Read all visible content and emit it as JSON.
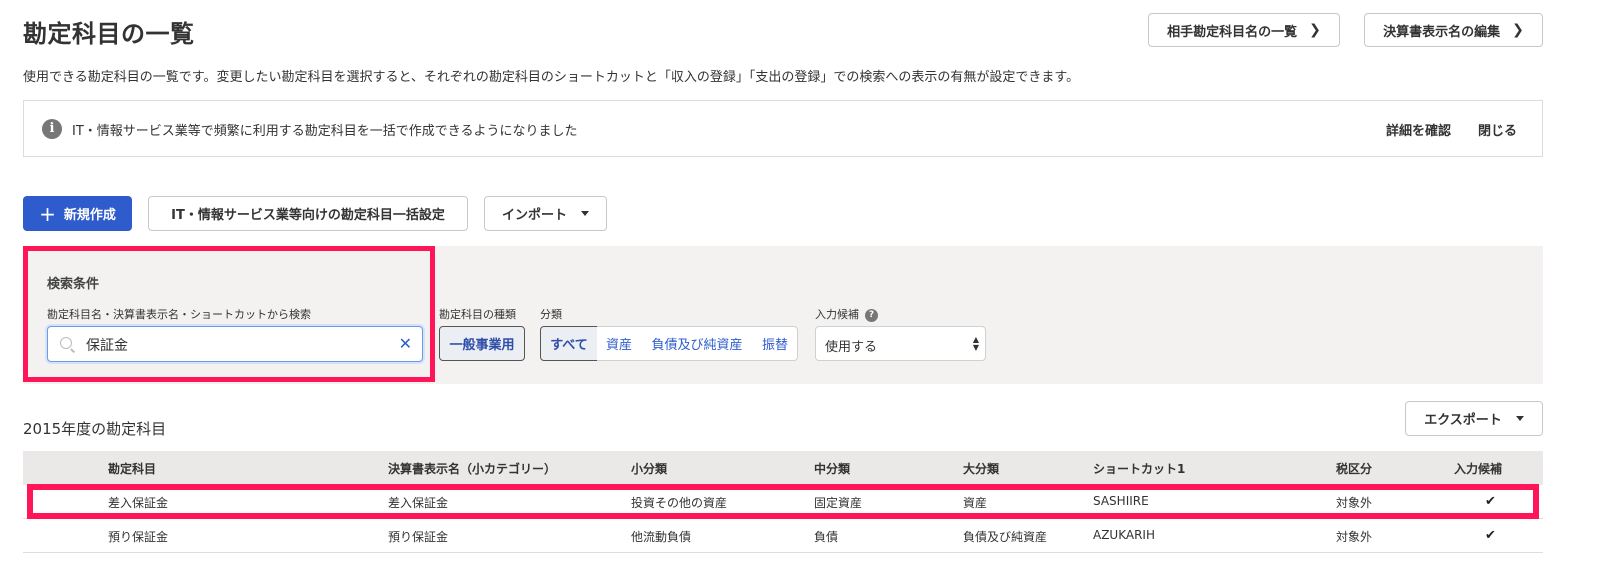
{
  "header": {
    "title": "勘定科目の一覧",
    "counter_accounts_label": "相手勘定科目名の一覧",
    "edit_statement_names_label": "決算書表示名の編集"
  },
  "description": "使用できる勘定科目の一覧です。変更したい勘定科目を選択すると、それぞれの勘定科目のショートカットと「収入の登録」「支出の登録」での検索への表示の有無が設定できます。",
  "notice": {
    "icon": "info-icon",
    "text": "IT・情報サービス業等で頻繁に利用する勘定科目を一括で作成できるようになりました",
    "details_label": "詳細を確認",
    "close_label": "閉じる"
  },
  "toolbar": {
    "new_label": "新規作成",
    "bulk_setup_label": "IT・情報サービス業等向けの勘定科目一括設定",
    "import_label": "インポート"
  },
  "filters": {
    "heading": "検索条件",
    "search_label": "勘定科目名・決算書表示名・ショートカットから検索",
    "search_value": "保証金",
    "type_label": "勘定科目の種類",
    "type_value": "一般事業用",
    "category_label": "分類",
    "categories": [
      "すべて",
      "資産",
      "負債及び純資産",
      "振替"
    ],
    "active_category": "すべて",
    "input_candidate_label": "入力候補",
    "input_candidate_value": "使用する"
  },
  "section": {
    "title": "2015年度の勘定科目",
    "export_label": "エクスポート"
  },
  "table": {
    "columns": [
      "勘定科目",
      "決算書表示名（小カテゴリー）",
      "小分類",
      "中分類",
      "大分類",
      "ショートカット1",
      "税区分",
      "入力候補"
    ],
    "rows": [
      {
        "account": "差入保証金",
        "display_name": "差入保証金",
        "sub": "投資その他の資産",
        "mid": "固定資産",
        "major": "資産",
        "shortcut": "SASHIIRE",
        "tax": "対象外",
        "candidate": "✔"
      },
      {
        "account": "預り保証金",
        "display_name": "預り保証金",
        "sub": "他流動負債",
        "mid": "負債",
        "major": "負債及び純資産",
        "shortcut": "AZUKARIH",
        "tax": "対象外",
        "candidate": "✔"
      }
    ]
  },
  "colors": {
    "primary": "#2f5ccc",
    "highlight": "#ff1558",
    "filter_bg": "#f3f2f1"
  }
}
